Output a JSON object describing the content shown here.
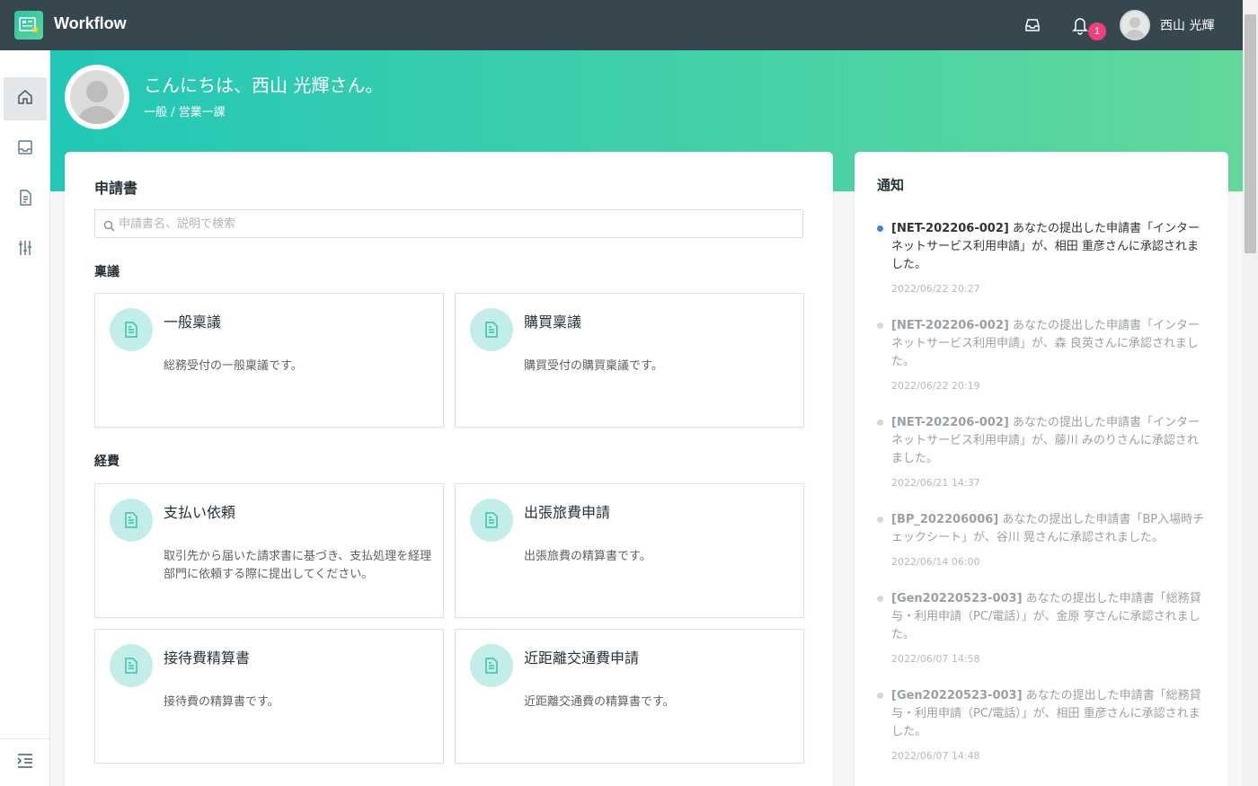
{
  "app": {
    "title": "Workflow"
  },
  "header": {
    "notification_count": "1",
    "user_name": "西山 光輝"
  },
  "hero": {
    "greeting": "こんにちは、西山 光輝さん。",
    "department": "一般 / 営業一課"
  },
  "forms": {
    "title": "申請書",
    "search_placeholder": "申請書名、説明で検索",
    "categories": [
      {
        "name": "稟議",
        "cards": [
          {
            "title": "一般稟議",
            "desc": "総務受付の一般稟議です。"
          },
          {
            "title": "購買稟議",
            "desc": "購買受付の購買稟議です。"
          }
        ]
      },
      {
        "name": "経費",
        "cards": [
          {
            "title": "支払い依頼",
            "desc": "取引先から届いた請求書に基づき、支払処理を経理部門に依頼する際に提出してください。"
          },
          {
            "title": "出張旅費申請",
            "desc": "出張旅費の精算書です。"
          },
          {
            "title": "接待費精算書",
            "desc": "接待費の精算書です。"
          },
          {
            "title": "近距離交通費申請",
            "desc": "近距離交通費の精算書です。"
          }
        ]
      }
    ]
  },
  "notifications": {
    "title": "通知",
    "items": [
      {
        "code": "[NET-202206-002]",
        "text": " あなたの提出した申請書「インターネットサービス利用申請」が、相田 重彦さんに承認されました。",
        "time": "2022/06/22 20:27",
        "unread": true
      },
      {
        "code": "[NET-202206-002]",
        "text": " あなたの提出した申請書「インターネットサービス利用申請」が、森 良英さんに承認されました。",
        "time": "2022/06/22 20:19",
        "unread": false
      },
      {
        "code": "[NET-202206-002]",
        "text": " あなたの提出した申請書「インターネットサービス利用申請」が、藤川 みのりさんに承認されました。",
        "time": "2022/06/21 14:37",
        "unread": false
      },
      {
        "code": "[BP_202206006]",
        "text": " あなたの提出した申請書「BP入場時チェックシート」が、谷川 晃さんに承認されました。",
        "time": "2022/06/14 06:00",
        "unread": false
      },
      {
        "code": "[Gen20220523-003]",
        "text": " あなたの提出した申請書「総務貸与・利用申請（PC/電話）」が、金原 亨さんに承認されました。",
        "time": "2022/06/07 14:58",
        "unread": false
      },
      {
        "code": "[Gen20220523-003]",
        "text": " あなたの提出した申請書「総務貸与・利用申請（PC/電話）」が、相田 重彦さんに承認されました。",
        "time": "2022/06/07 14:48",
        "unread": false
      }
    ]
  },
  "icons": {
    "logo": "workflow-logo-icon",
    "inbox": "inbox-icon",
    "bell": "bell-icon",
    "home": "home-icon",
    "doc": "document-icon",
    "settings": "sliders-icon",
    "menu": "menu-indent-icon"
  },
  "colors": {
    "header_bg": "#37474f",
    "hero_start": "#22c7b6",
    "hero_end": "#62d89a",
    "badge": "#f0407a",
    "card_icon_bg": "#c2ede9",
    "card_icon_fg": "#3bbfae",
    "unread_dot": "#4a7de0"
  }
}
